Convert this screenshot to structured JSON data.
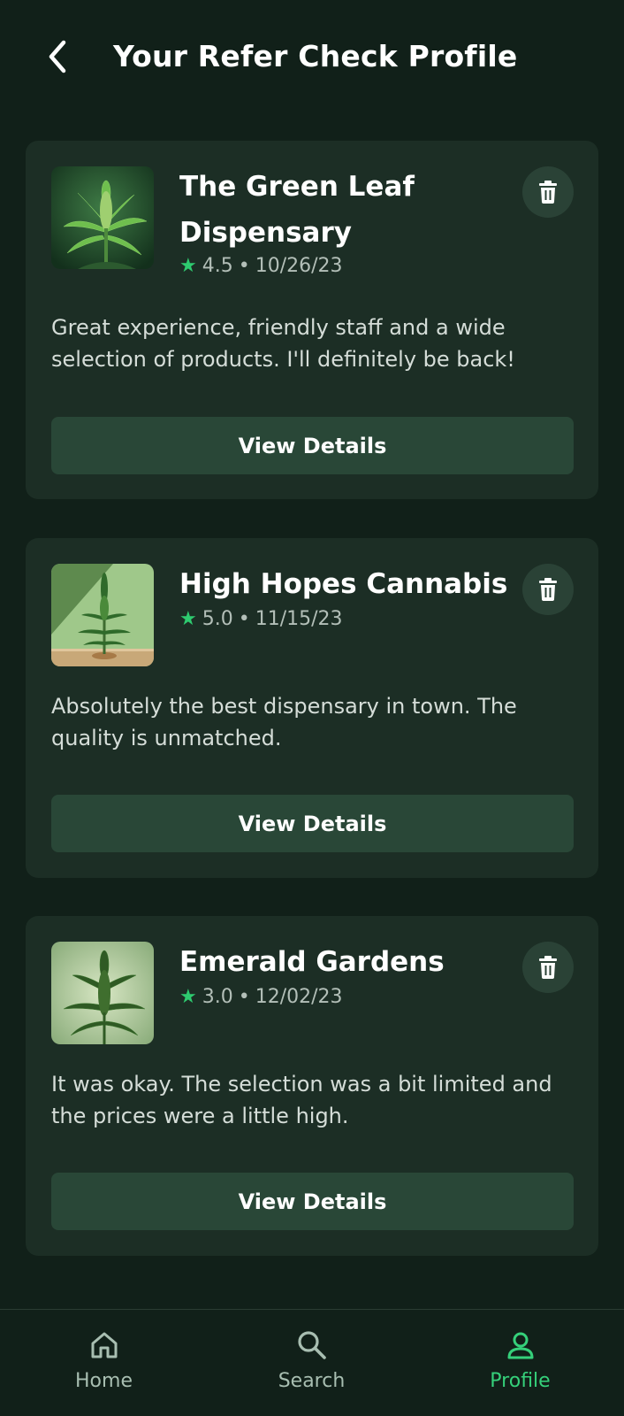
{
  "header": {
    "title": "Your Refer Check Profile",
    "back_icon": "chevron-left-icon"
  },
  "colors": {
    "background": "#112019",
    "card": "#1c2e25",
    "button": "#294737",
    "accent_green": "#35d07a",
    "star": "#2ecb6f"
  },
  "reviews": [
    {
      "name": "The Green Leaf Dispensary",
      "rating": "4.5",
      "date": "10/26/23",
      "text": "Great experience, friendly staff and a wide selection of products. I'll definitely be back!",
      "button_label": "View Details",
      "delete_icon": "trash-icon",
      "image_icon": "cannabis-plant-image"
    },
    {
      "name": "High Hopes Cannabis",
      "rating": "5.0",
      "date": "11/15/23",
      "text": "Absolutely the best dispensary in town. The quality is unmatched.",
      "button_label": "View Details",
      "delete_icon": "trash-icon",
      "image_icon": "cannabis-plant-image"
    },
    {
      "name": "Emerald Gardens",
      "rating": "3.0",
      "date": "12/02/23",
      "text": "It was okay. The selection was a bit limited and the prices were a little high.",
      "button_label": "View Details",
      "delete_icon": "trash-icon",
      "image_icon": "cannabis-plant-image"
    }
  ],
  "nav": {
    "items": [
      {
        "label": "Home",
        "icon": "home-icon",
        "active": false
      },
      {
        "label": "Search",
        "icon": "search-icon",
        "active": false
      },
      {
        "label": "Profile",
        "icon": "profile-icon",
        "active": true
      }
    ]
  },
  "symbols": {
    "star": "★",
    "separator": "•"
  }
}
